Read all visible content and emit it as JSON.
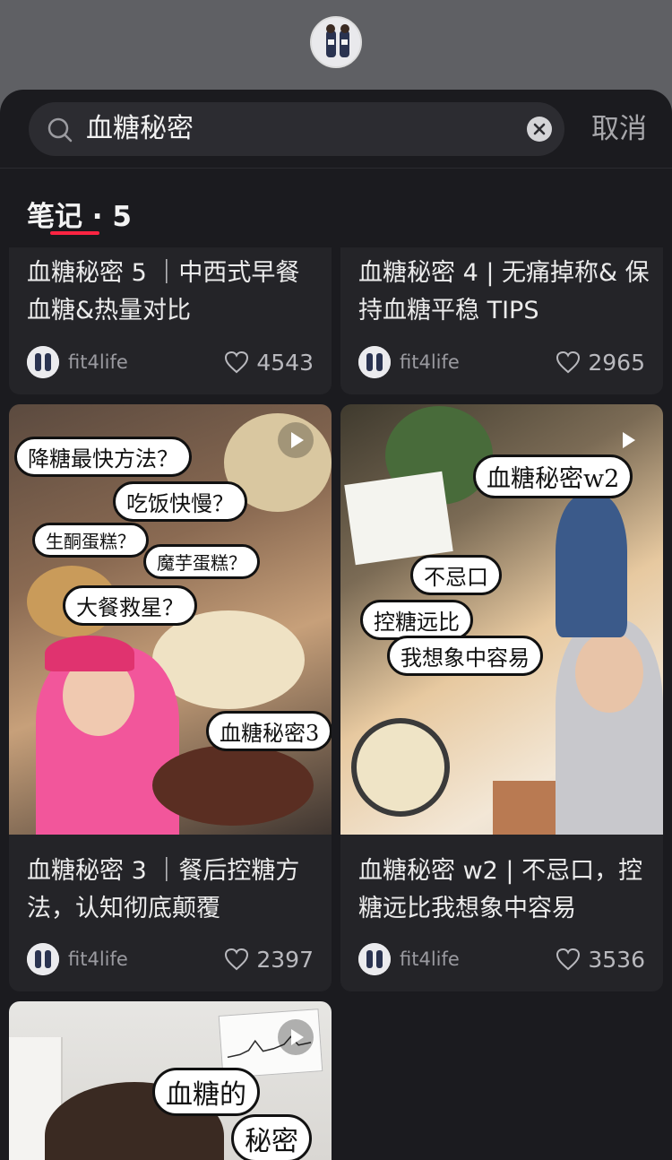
{
  "search": {
    "query": "血糖秘密",
    "cancel_label": "取消"
  },
  "tab": {
    "label": "笔记 · 5"
  },
  "notes": [
    {
      "title": "血糖秘密 5 ｜中西式早餐 血糖&热量对比",
      "author": "fit4life",
      "likes": "4543"
    },
    {
      "title": "血糖秘密 4 | 无痛掉称& 保持血糖平稳 TIPS",
      "author": "fit4life",
      "likes": "2965"
    },
    {
      "title": "血糖秘密 3 ｜餐后控糖方法，认知彻底颠覆",
      "author": "fit4life",
      "likes": "2397",
      "bubbles": [
        "降糖最快方法？",
        "吃饭快慢？",
        "生酮蛋糕？",
        "魔芋蛋糕？",
        "大餐救星？",
        "血糖秘密3"
      ]
    },
    {
      "title": "血糖秘密 w2 | 不忌口，控糖远比我想象中容易",
      "author": "fit4life",
      "likes": "3536",
      "bubbles": [
        "血糖秘密w2",
        "不忌口",
        "控糖远比",
        "我想象中容易"
      ]
    },
    {
      "bubbles": [
        "血糖的",
        "秘密"
      ]
    }
  ],
  "colors": {
    "accent": "#ff2442",
    "background": "#1b1b1f",
    "card": "#242428"
  }
}
